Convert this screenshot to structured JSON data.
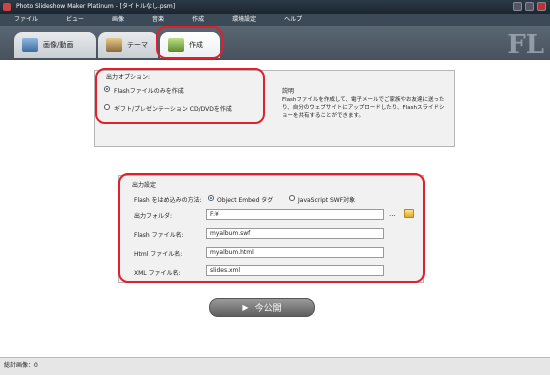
{
  "window": {
    "title": "Photo Slideshow Maker Platinum - [タイトルなし.psm]"
  },
  "menu": [
    "ファイル",
    "ビュー",
    "画像",
    "音楽",
    "作成",
    "環境設定",
    "ヘルプ"
  ],
  "tabs": [
    {
      "label": "画像/動画"
    },
    {
      "label": "テーマ"
    },
    {
      "label": "作成"
    }
  ],
  "output_options": {
    "title": "出力オプション:",
    "option_flash": "Flashファイルのみを作成",
    "option_gift": "ギフト/プレゼンテーション CD/DVDを作成",
    "desc_title": "説明",
    "desc_text": "Flashファイルを作成して、電子メールでご家族やお友達に送ったり、自分のウェブサイトにアップロードしたり、Flashスライドショーを共有することができます。"
  },
  "output_settings": {
    "title": "出力設定",
    "embed_label": "Flash をはめ込みの方法:",
    "embed_option1": "Object Embed タグ",
    "embed_option2": "JavaScript SWF対象",
    "folder_label": "出力フォルダ:",
    "folder_value": "F:¥",
    "flash_name_label": "Flash ファイル名:",
    "flash_name_value": "myalbum.swf",
    "html_name_label": "Html ファイル名:",
    "html_name_value": "myalbum.html",
    "xml_name_label": "XML ファイル名:",
    "xml_name_value": "slides.xml",
    "browse_label": "..."
  },
  "publish_button": {
    "label": "今公開",
    "icon": "play-icon"
  },
  "status": {
    "text": "総計画像：0"
  }
}
